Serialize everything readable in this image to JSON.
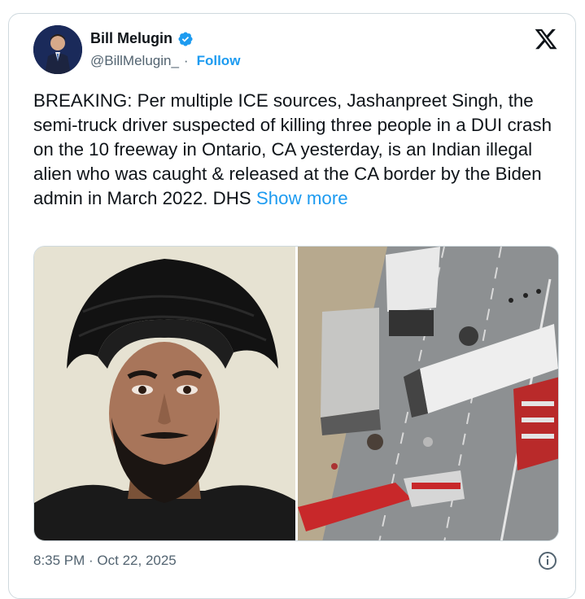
{
  "author": {
    "name": "Bill Melugin",
    "handle": "@BillMelugin_",
    "separator": "·",
    "follow_label": "Follow"
  },
  "tweet": {
    "text": "BREAKING: Per multiple ICE sources, Jashanpreet Singh, the semi-truck driver suspected of killing three people in a DUI crash on the 10 freeway in Ontario, CA yesterday, is an Indian illegal alien who was caught & released at the CA border by the Biden admin in March 2022. DHS ",
    "show_more_label": "Show more"
  },
  "footer": {
    "timestamp": "8:35 PM · Oct 22, 2025"
  },
  "colors": {
    "accent": "#1d9bf0",
    "text": "#0f1419",
    "secondary": "#536471",
    "border": "#cfd9de"
  },
  "icons": {
    "verified": "verified-badge-icon",
    "platform": "x-logo-icon",
    "info": "info-icon"
  }
}
